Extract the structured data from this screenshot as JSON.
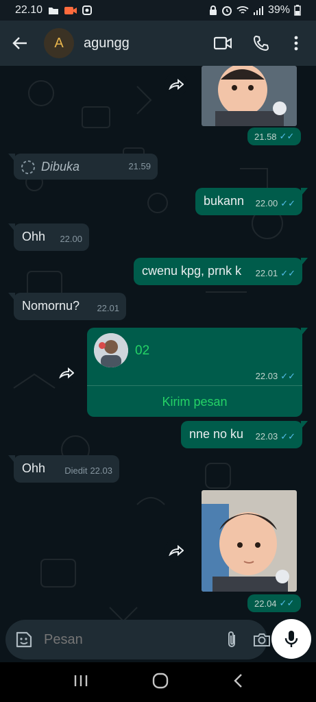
{
  "status_bar": {
    "time": "22.10",
    "battery": "39%"
  },
  "header": {
    "avatar_letter": "A",
    "contact_name": "agungg"
  },
  "messages": {
    "sticker1": {
      "time": "21.58"
    },
    "opened": {
      "text": "Dibuka",
      "time": "21.59"
    },
    "m1": {
      "text": "bukann",
      "time": "22.00"
    },
    "m2": {
      "text": "Ohh",
      "time": "22.00"
    },
    "m3": {
      "text": "cwenu kpg, prnk k",
      "time": "22.01"
    },
    "m4": {
      "text": "Nomornu?",
      "time": "22.01"
    },
    "contact_card": {
      "name": "02",
      "time": "22.03",
      "action": "Kirim pesan"
    },
    "m5": {
      "text": "nne no ku",
      "time": "22.03"
    },
    "m6": {
      "text": "Ohh",
      "edited": "Diedit",
      "time": "22.03"
    },
    "sticker2": {
      "time": "22.04"
    }
  },
  "composer": {
    "placeholder": "Pesan"
  },
  "colors": {
    "outgoing": "#005c4b",
    "incoming": "#1f2c34",
    "read_ticks": "#53bdeb",
    "accent": "#25d366",
    "avatar": "#e8b54d"
  }
}
